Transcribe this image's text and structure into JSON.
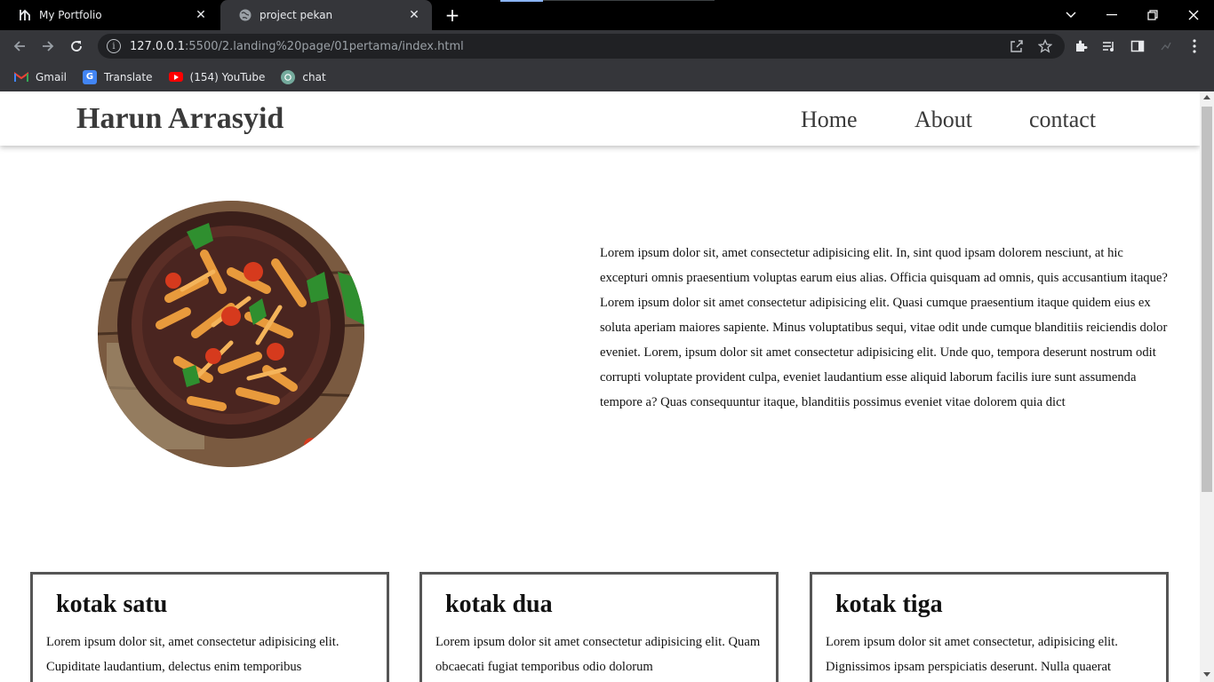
{
  "browser": {
    "tabs": [
      {
        "title": "My Portfolio",
        "icon": "portfolio-logo-icon"
      },
      {
        "title": "project pekan",
        "icon": "globe-icon"
      }
    ],
    "url_host": "127.0.0.1",
    "url_path": ":5500/2.landing%20page/01pertama/index.html",
    "bookmarks": [
      {
        "label": "Gmail",
        "icon": "gmail-icon"
      },
      {
        "label": "Translate",
        "icon": "translate-icon"
      },
      {
        "label": "(154) YouTube",
        "icon": "youtube-icon"
      },
      {
        "label": "chat",
        "icon": "chatgpt-icon"
      }
    ]
  },
  "site": {
    "brand": "Harun Arrasyid",
    "nav": [
      "Home",
      "About",
      "contact"
    ],
    "about_text": "Lorem ipsum dolor sit, amet consectetur adipisicing elit. In, sint quod ipsam dolorem nesciunt, at hic excepturi omnis praesentium voluptas earum eius alias. Officia quisquam ad omnis, quis accusantium itaque? Lorem ipsum dolor sit amet consectetur adipisicing elit. Quasi cumque praesentium itaque quidem eius ex soluta aperiam maiores sapiente. Minus voluptatibus sequi, vitae odit unde cumque blanditiis reiciendis dolor eveniet. Lorem, ipsum dolor sit amet consectetur adipisicing elit. Unde quo, tempora deserunt nostrum odit corrupti voluptate provident culpa, eveniet laudantium esse aliquid laborum facilis iure sunt assumenda tempore a? Quas consequuntur itaque, blanditiis possimus eveniet vitae dolorem quia dict",
    "boxes": [
      {
        "title": "kotak satu",
        "text": "Lorem ipsum dolor sit, amet consectetur adipisicing elit. Cupiditate laudantium, delectus enim temporibus"
      },
      {
        "title": "kotak dua",
        "text": "Lorem ipsum dolor sit amet consectetur adipisicing elit. Quam obcaecati fugiat temporibus odio dolorum"
      },
      {
        "title": "kotak tiga",
        "text": "Lorem ipsum dolor sit amet consectetur, adipisicing elit. Dignissimos ipsam perspiciatis deserunt. Nulla quaerat"
      }
    ]
  }
}
